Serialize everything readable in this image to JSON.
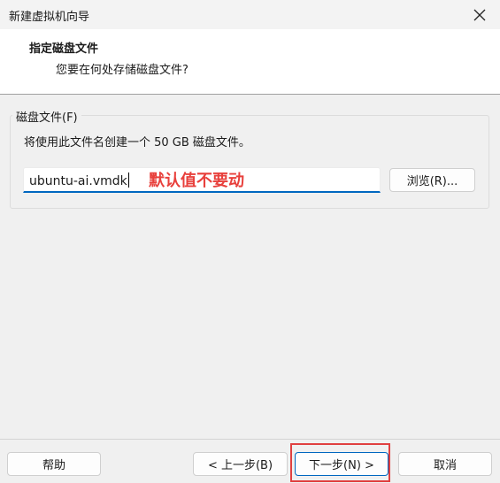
{
  "window": {
    "title": "新建虚拟机向导"
  },
  "header": {
    "title": "指定磁盘文件",
    "subtitle": "您要在何处存储磁盘文件?"
  },
  "disk_file_group": {
    "legend": "磁盘文件(F)",
    "description": "将使用此文件名创建一个 50 GB 磁盘文件。",
    "file_name_value": "ubuntu-ai.vmdk",
    "browse_label": "浏览(R)..."
  },
  "annotation": {
    "text": "默认值不要动",
    "color": "#e8403c"
  },
  "footer": {
    "help_label": "帮助",
    "back_label": "< 上一步(B)",
    "next_label": "下一步(N) >",
    "cancel_label": "取消"
  },
  "icons": {
    "close": "close-icon"
  },
  "colors": {
    "accent": "#0067c0",
    "highlight": "#e04040"
  }
}
